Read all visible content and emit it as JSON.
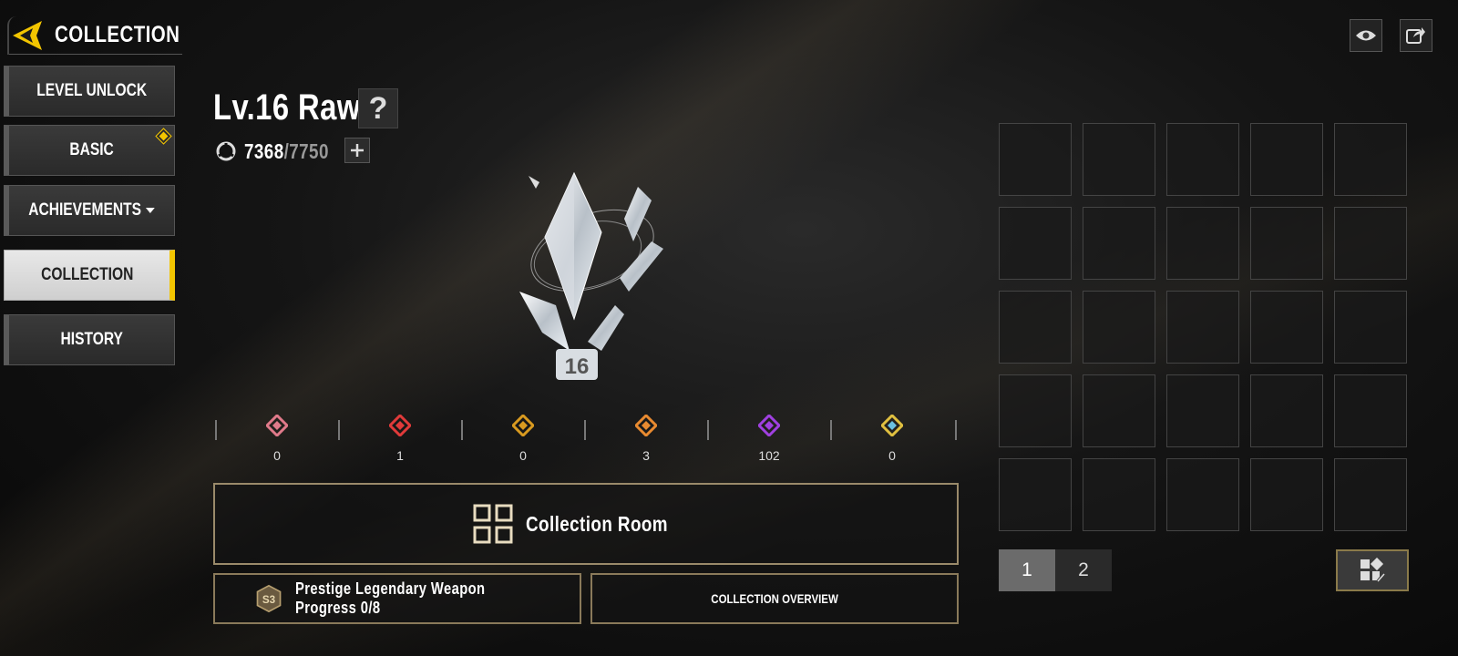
{
  "header": {
    "title": "COLLECTION"
  },
  "sidebar": {
    "items": [
      {
        "label": "LEVEL UNLOCK"
      },
      {
        "label": "BASIC"
      },
      {
        "label": "ACHIEVEMENTS"
      },
      {
        "label": "COLLECTION"
      },
      {
        "label": "HISTORY"
      }
    ]
  },
  "level": {
    "title": "Lv.16 Raw",
    "help": "?",
    "xp_current": "7368",
    "xp_max": "/7750",
    "badge_number": "16"
  },
  "stats": [
    {
      "icon": "pink-rarity-icon",
      "color": "#e07a8a",
      "value": "0"
    },
    {
      "icon": "red-rarity-icon",
      "color": "#e03a3a",
      "value": "1"
    },
    {
      "icon": "gold-rarity-icon",
      "color": "#d89a20",
      "value": "0"
    },
    {
      "icon": "orange-rarity-icon",
      "color": "#e88a30",
      "value": "3"
    },
    {
      "icon": "purple-rarity-icon",
      "color": "#a040e0",
      "value": "102"
    },
    {
      "icon": "rainbow-rarity-icon",
      "color": "#6ac0e0",
      "value": "0"
    }
  ],
  "buttons": {
    "collection_room": "Collection Room",
    "prestige": "Prestige Legendary Weapon Progress 0/8",
    "prestige_badge": "S3",
    "overview": "COLLECTION OVERVIEW"
  },
  "grid": {
    "rows": 5,
    "columns": 5
  },
  "pagination": {
    "pages": [
      "1",
      "2"
    ],
    "active": "1"
  }
}
